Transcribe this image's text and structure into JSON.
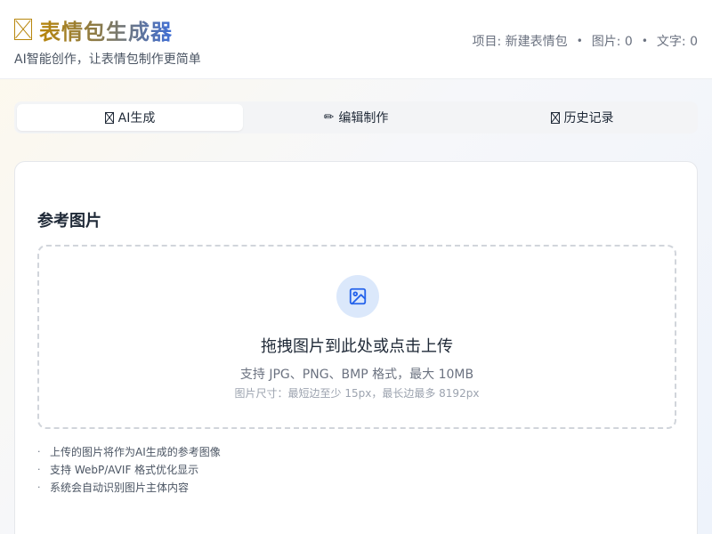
{
  "header": {
    "title": "表情包生成器",
    "subtitle": "AI智能创作，让表情包制作更简单",
    "stats": {
      "project": "项目: 新建表情包",
      "images": "图片: 0",
      "text": "文字: 0",
      "separator": "•"
    }
  },
  "tabs": [
    {
      "label": "AI生成",
      "icon": "image-placeholder-icon",
      "active": true
    },
    {
      "label": "编辑制作",
      "icon": "pencil-icon",
      "glyph": "✏",
      "active": false
    },
    {
      "label": "历史记录",
      "icon": "history-placeholder-icon",
      "active": false
    }
  ],
  "reference": {
    "title": "参考图片",
    "upload_main": "拖拽图片到此处或点击上传",
    "upload_formats": "支持 JPG、PNG、BMP 格式，最大 10MB",
    "upload_size": "图片尺寸：最短边至少 15px，最长边最多 8192px",
    "upload_icon": "image-icon",
    "tips": [
      "上传的图片将作为AI生成的参考图像",
      "支持 WebP/AVIF 格式优化显示",
      "系统会自动识别图片主体内容"
    ],
    "tip_bullet": "·"
  },
  "colors": {
    "accent_blue": "#2563eb",
    "brand_gold": "#b8860b",
    "icon_circle_bg": "#dbe8fb"
  }
}
